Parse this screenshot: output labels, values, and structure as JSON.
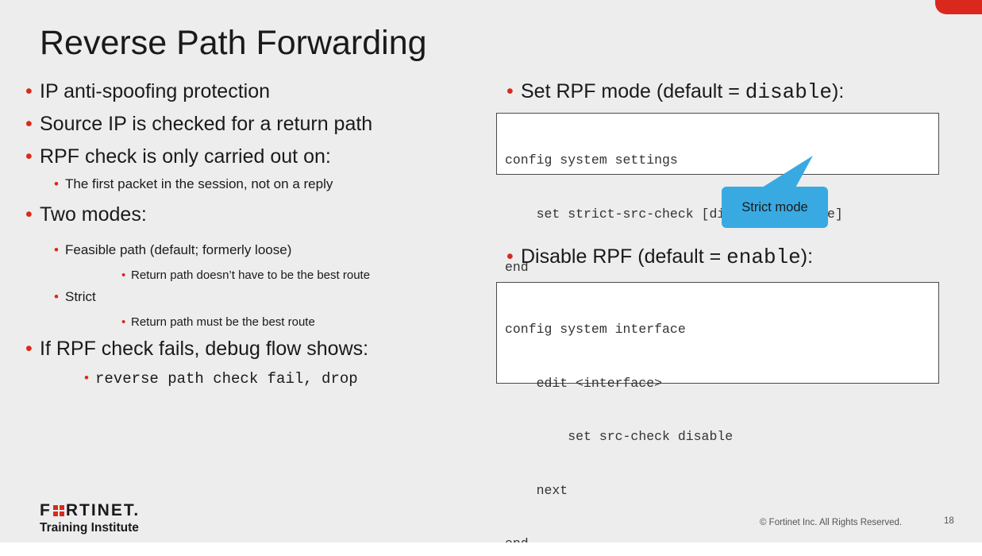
{
  "slide": {
    "title": "Reverse Path Forwarding",
    "left_bullets": {
      "b1": "IP anti-spoofing protection",
      "b2": "Source IP is checked for a return path",
      "b3": "RPF check is only carried out on:",
      "b3_1": "The first packet in the session, not on a reply",
      "b4": "Two modes:",
      "b4_1": "Feasible path (default; formerly loose)",
      "b4_1_1": "Return path doesn’t have to be the best route",
      "b4_2": "Strict",
      "b4_2_1": "Return path must be the best route",
      "b5": "If RPF check fails, debug flow shows:",
      "b5_1": "reverse path check fail, drop"
    },
    "right": {
      "set_mode_prefix": "Set RPF mode (default = ",
      "set_mode_code": "disable",
      "set_mode_suffix": "):",
      "code1": [
        "config system settings",
        "    set strict-src-check [disable | enable]",
        "end"
      ],
      "callout": "Strict mode",
      "disable_prefix": "Disable RPF (default = ",
      "disable_code": "enable",
      "disable_suffix": "):",
      "code2": [
        "config system interface",
        "    edit <interface>",
        "        set src-check disable",
        "    next",
        "end"
      ]
    },
    "footer": {
      "logo_left": "F",
      "logo_right": "RTINET.",
      "logo_sub": "Training Institute",
      "copyright": "© Fortinet Inc. All Rights Reserved.",
      "page": "18"
    },
    "colors": {
      "accent": "#da291c",
      "callout": "#39aae1",
      "background": "#ededed"
    }
  }
}
